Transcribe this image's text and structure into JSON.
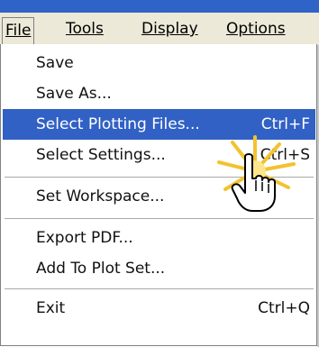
{
  "menubar": {
    "items": [
      {
        "label": "File",
        "accelerator": "F"
      },
      {
        "label": "Tools",
        "accelerator": "T"
      },
      {
        "label": "Display",
        "accelerator": "D"
      },
      {
        "label": "Options",
        "accelerator": "O"
      }
    ],
    "active_index": 0
  },
  "file_menu": {
    "items": [
      {
        "label": "Save",
        "shortcut": ""
      },
      {
        "label": "Save As...",
        "shortcut": ""
      },
      {
        "label": "Select Plotting Files...",
        "shortcut": "Ctrl+F",
        "highlighted": true
      },
      {
        "label": "Select Settings...",
        "shortcut": "Ctrl+S"
      },
      {
        "label": "Set Workspace...",
        "shortcut": ""
      },
      {
        "label": "Export PDF...",
        "shortcut": ""
      },
      {
        "label": "Add To Plot Set...",
        "shortcut": ""
      },
      {
        "label": "Exit",
        "shortcut": "Ctrl+Q"
      }
    ]
  },
  "colors": {
    "highlight": "#3161c4",
    "title_strip": "#2f63c7",
    "menubar_bg": "#ece9d8",
    "burst": "#f2c230"
  },
  "icons": [
    "hand-pointer-icon",
    "click-burst-icon"
  ]
}
